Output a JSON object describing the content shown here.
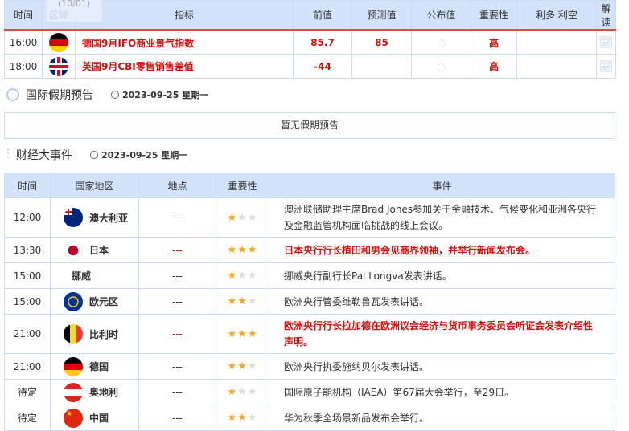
{
  "tooltip": "(10/01)",
  "indicators": {
    "headers": [
      "时间",
      "区域",
      "指标",
      "前值",
      "预测值",
      "公布值",
      "重要性",
      "利多 利空",
      "解读"
    ],
    "rows": [
      {
        "time": "16:00",
        "flag": "de",
        "name": "德国9月IFO商业景气指数",
        "prev": "85.7",
        "forecast": "85",
        "actual": "",
        "importance": "高"
      },
      {
        "time": "18:00",
        "flag": "gb",
        "name": "英国9月CBI零售销售差值",
        "prev": "-44",
        "forecast": "",
        "actual": "",
        "importance": "高"
      }
    ]
  },
  "holiday": {
    "title": "国际假期预告",
    "date": "2023-09-25 星期一",
    "empty": "暂无假期预告"
  },
  "events": {
    "title": "财经大事件",
    "date": "2023-09-25 星期一",
    "headers": [
      "时间",
      "国家地区",
      "地点",
      "重要性",
      "事件"
    ],
    "rows": [
      {
        "time": "12:00",
        "flag": "au",
        "country": "澳大利亚",
        "place": "---",
        "stars": 1,
        "event": "澳洲联储助理主席Brad Jones参加关于金融技术、气候变化和亚洲各央行及金融监管机构面临挑战的线上会议。",
        "hot": false
      },
      {
        "time": "13:30",
        "flag": "jp",
        "country": "日本",
        "place": "---",
        "stars": 3,
        "event": "日本央行行长植田和男会见商界领袖，并举行新闻发布会。",
        "hot": true
      },
      {
        "time": "15:00",
        "flag": "",
        "country": "挪威",
        "place": "---",
        "stars": 1,
        "event": "挪威央行副行长Pal Longva发表讲话。",
        "hot": false
      },
      {
        "time": "15:00",
        "flag": "eu",
        "country": "欧元区",
        "place": "---",
        "stars": 2,
        "event": "欧洲央行管委维勒鲁瓦发表讲话。",
        "hot": false
      },
      {
        "time": "21:00",
        "flag": "be",
        "country": "比利时",
        "place": "---",
        "stars": 3,
        "event": "欧洲央行行长拉加德在欧洲议会经济与货币事务委员会听证会发表介绍性声明。",
        "hot": true
      },
      {
        "time": "21:00",
        "flag": "de",
        "country": "德国",
        "place": "---",
        "stars": 2,
        "event": "欧洲央行执委施纳贝尔发表讲话。",
        "hot": false
      },
      {
        "time": "待定",
        "flag": "at",
        "country": "奥地利",
        "place": "---",
        "stars": 1,
        "event": "国际原子能机构（IAEA）第67届大会举行，至29日。",
        "hot": false
      },
      {
        "time": "待定",
        "flag": "cn",
        "country": "中国",
        "place": "---",
        "stars": 2,
        "event": "华为秋季全场景新品发布会举行。",
        "hot": false
      }
    ]
  }
}
